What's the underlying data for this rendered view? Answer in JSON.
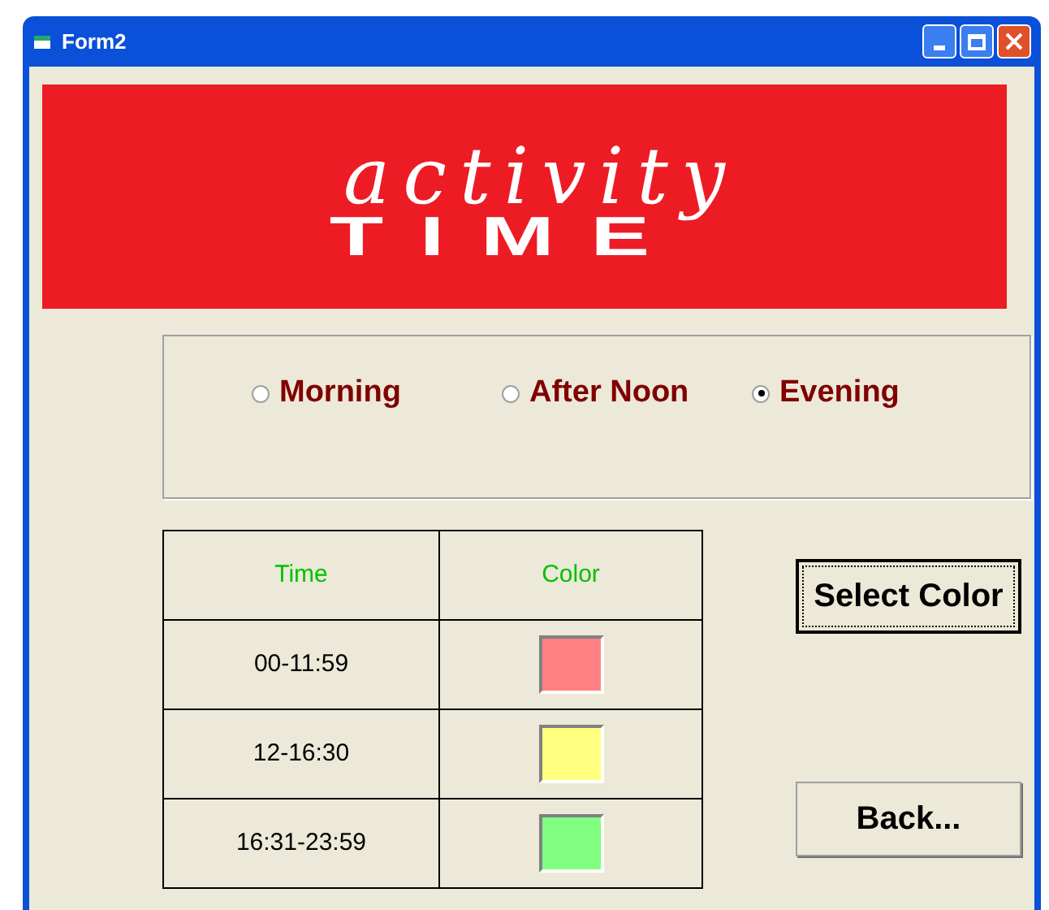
{
  "window": {
    "title": "Form2"
  },
  "banner": {
    "line_1": "activity",
    "line_2": "TIME"
  },
  "options": [
    {
      "label": "Morning",
      "selected": false
    },
    {
      "label": "After Noon",
      "selected": false
    },
    {
      "label": "Evening",
      "selected": true
    }
  ],
  "table": {
    "columns": [
      "Time",
      "Color"
    ],
    "rows": [
      {
        "time": "00-11:59",
        "color": "#ff8080"
      },
      {
        "time": "12-16:30",
        "color": "#ffff80"
      },
      {
        "time": "16:31-23:59",
        "color": "#80ff80"
      }
    ]
  },
  "buttons": [
    "Select Color",
    "Back..."
  ]
}
